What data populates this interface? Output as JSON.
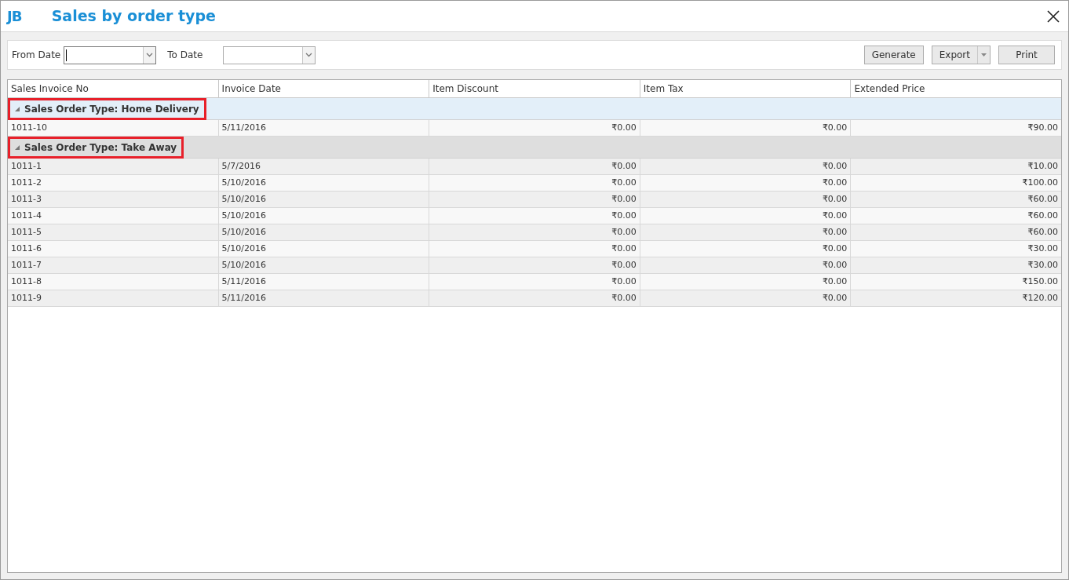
{
  "window": {
    "title": "Sales by order type",
    "logo": "JB"
  },
  "filters": [
    {
      "label": "From Date",
      "focused": true
    },
    {
      "label": "To Date",
      "focused": false
    }
  ],
  "buttons": [
    {
      "label": "Generate",
      "kind": "plain"
    },
    {
      "label": "Export",
      "kind": "split"
    },
    {
      "label": "Print",
      "kind": "plain"
    }
  ],
  "table": {
    "columns": [
      "Sales Invoice No",
      "Invoice Date",
      "Item Discount",
      "Item Tax",
      "Extended Price"
    ],
    "groups": [
      {
        "label": "Sales Order Type: Home Delivery",
        "expanded": true,
        "selected": true,
        "highlighted": true,
        "rows": [
          [
            "1011-10",
            "5/11/2016",
            "₹0.00",
            "₹0.00",
            "₹90.00"
          ]
        ]
      },
      {
        "label": "Sales Order Type: Take Away",
        "expanded": true,
        "selected": false,
        "highlighted": true,
        "rows": [
          [
            "1011-1",
            "5/7/2016",
            "₹0.00",
            "₹0.00",
            "₹10.00"
          ],
          [
            "1011-2",
            "5/10/2016",
            "₹0.00",
            "₹0.00",
            "₹100.00"
          ],
          [
            "1011-3",
            "5/10/2016",
            "₹0.00",
            "₹0.00",
            "₹60.00"
          ],
          [
            "1011-4",
            "5/10/2016",
            "₹0.00",
            "₹0.00",
            "₹60.00"
          ],
          [
            "1011-5",
            "5/10/2016",
            "₹0.00",
            "₹0.00",
            "₹60.00"
          ],
          [
            "1011-6",
            "5/10/2016",
            "₹0.00",
            "₹0.00",
            "₹30.00"
          ],
          [
            "1011-7",
            "5/10/2016",
            "₹0.00",
            "₹0.00",
            "₹30.00"
          ],
          [
            "1011-8",
            "5/11/2016",
            "₹0.00",
            "₹0.00",
            "₹150.00"
          ],
          [
            "1011-9",
            "5/11/2016",
            "₹0.00",
            "₹0.00",
            "₹120.00"
          ]
        ]
      }
    ]
  }
}
